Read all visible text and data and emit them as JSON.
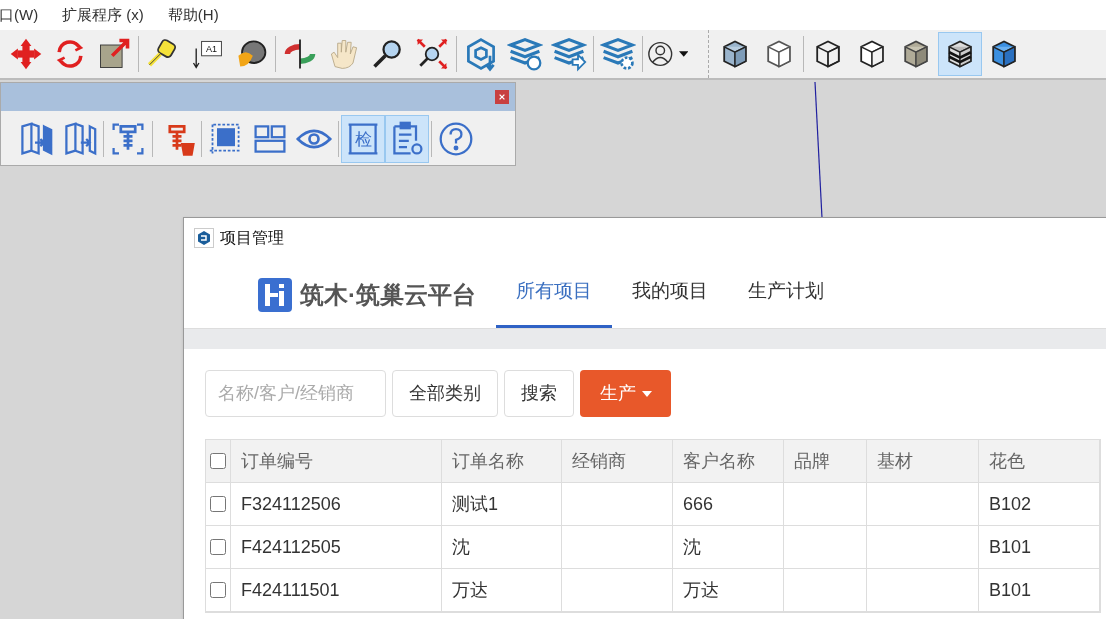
{
  "menu_bar": [
    {
      "label": "口(W)"
    },
    {
      "label": "扩展程序 (x)"
    },
    {
      "label": "帮助(H)"
    }
  ],
  "toolbar": {
    "buttons": [
      {
        "kind": "move",
        "selected": false
      },
      {
        "kind": "rotate",
        "selected": false
      },
      {
        "kind": "scale",
        "selected": false
      },
      {
        "kind": "sep"
      },
      {
        "kind": "tape",
        "selected": false
      },
      {
        "kind": "text",
        "label": "A1",
        "selected": false
      },
      {
        "kind": "paint",
        "selected": false
      },
      {
        "kind": "sep"
      },
      {
        "kind": "orbit",
        "selected": false
      },
      {
        "kind": "pan",
        "selected": false
      },
      {
        "kind": "zoom",
        "selected": false
      },
      {
        "kind": "zoom-extents",
        "selected": false
      },
      {
        "kind": "sep"
      },
      {
        "kind": "cube-down",
        "selected": false
      },
      {
        "kind": "layers-sync",
        "selected": false
      },
      {
        "kind": "layers-export",
        "selected": false
      },
      {
        "kind": "sep"
      },
      {
        "kind": "layers-gear",
        "selected": false
      },
      {
        "kind": "sep"
      },
      {
        "kind": "user",
        "selected": false
      },
      {
        "kind": "gap"
      },
      {
        "kind": "cube-xray",
        "selected": false
      },
      {
        "kind": "cube-hidden",
        "selected": false
      },
      {
        "kind": "sep"
      },
      {
        "kind": "cube-wire",
        "selected": false
      },
      {
        "kind": "cube-plain",
        "selected": false
      },
      {
        "kind": "cube-shaded",
        "selected": false
      },
      {
        "kind": "cube-striped",
        "selected": true
      },
      {
        "kind": "cube-textured",
        "selected": false
      }
    ]
  },
  "floating_toolbar": {
    "buttons": [
      {
        "kind": "door-move",
        "selected": false
      },
      {
        "kind": "door-open",
        "selected": false
      },
      {
        "kind": "sep"
      },
      {
        "kind": "screw-frame",
        "selected": false
      },
      {
        "kind": "sep"
      },
      {
        "kind": "screw-delete",
        "selected": false
      },
      {
        "kind": "sep"
      },
      {
        "kind": "select-square",
        "selected": false
      },
      {
        "kind": "grid",
        "selected": false
      },
      {
        "kind": "eye",
        "selected": false
      },
      {
        "kind": "sep"
      },
      {
        "kind": "check-label",
        "label": "检",
        "selected": true
      },
      {
        "kind": "clipboard-gear",
        "selected": true
      },
      {
        "kind": "sep"
      },
      {
        "kind": "help",
        "selected": false
      }
    ]
  },
  "dialog": {
    "title": "项目管理",
    "brand": "筑木·筑巢云平台",
    "tabs": [
      {
        "label": "所有项目",
        "selected": true
      },
      {
        "label": "我的项目",
        "selected": false
      },
      {
        "label": "生产计划",
        "selected": false
      }
    ],
    "search": {
      "placeholder": "名称/客户/经销商"
    },
    "category_button": "全部类别",
    "search_button": "搜索",
    "production_button": "生产",
    "table": {
      "header_checked": false,
      "columns": [
        "订单编号",
        "订单名称",
        "经销商",
        "客户名称",
        "品牌",
        "基材",
        "花色"
      ],
      "rows": [
        {
          "checked": false,
          "cells": [
            "F324112506",
            "测试1",
            "",
            "666",
            "",
            "",
            "B102"
          ]
        },
        {
          "checked": false,
          "cells": [
            "F424112505",
            "沈",
            "",
            "沈",
            "",
            "",
            "B101"
          ]
        },
        {
          "checked": false,
          "cells": [
            "F424111501",
            "万达",
            "",
            "万达",
            "",
            "",
            "B101"
          ]
        }
      ]
    }
  }
}
